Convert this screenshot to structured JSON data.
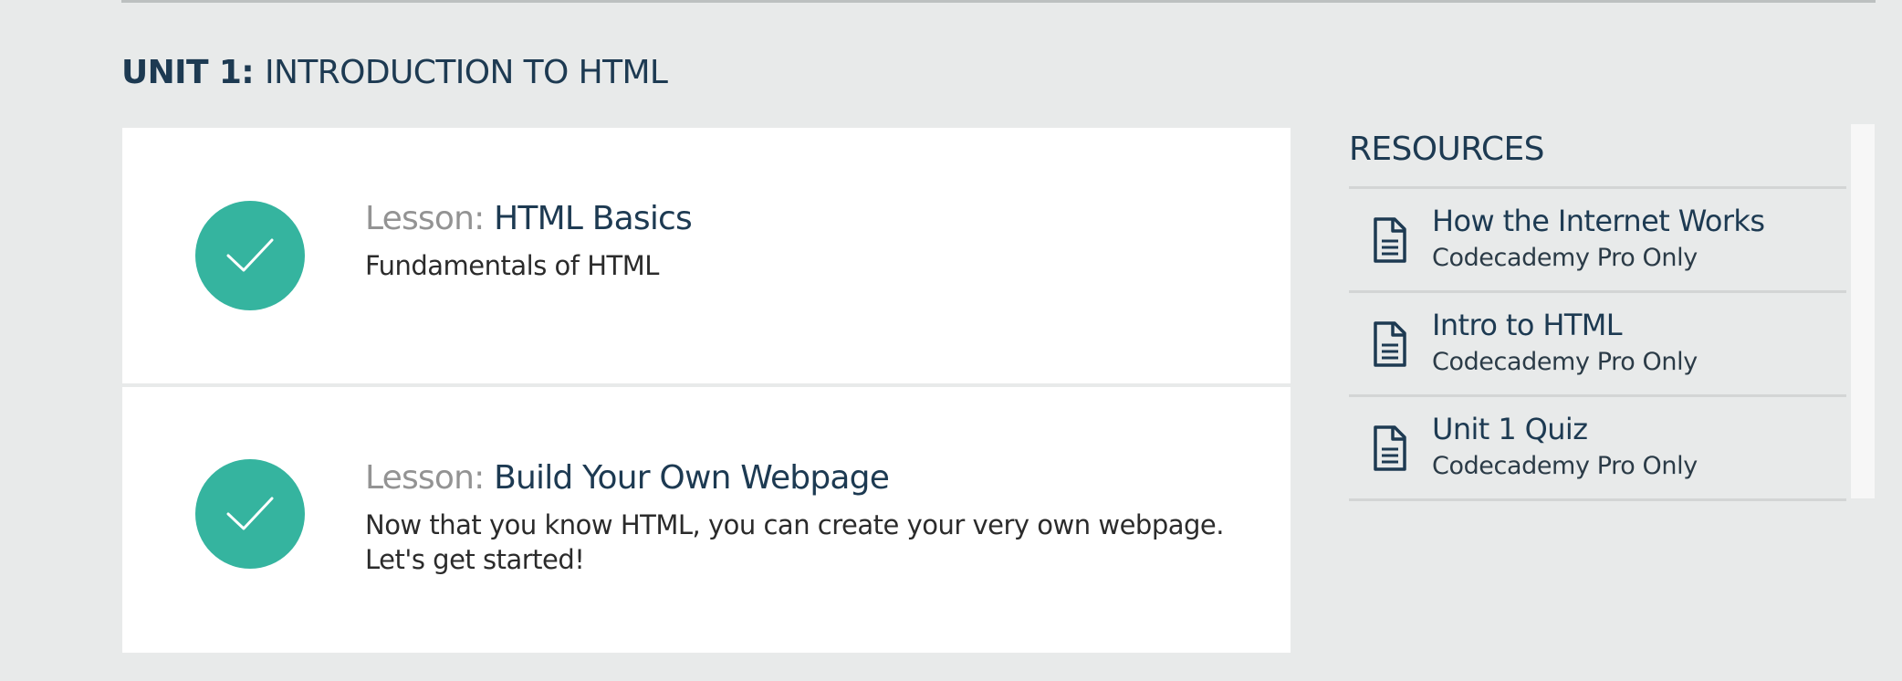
{
  "unit": {
    "number_label": "UNIT 1",
    "separator": ": ",
    "title": "INTRODUCTION TO HTML"
  },
  "lessons": [
    {
      "prefix": "Lesson: ",
      "title": "HTML Basics",
      "description": "Fundamentals of HTML",
      "status_icon": "checkmark-icon",
      "completed": true
    },
    {
      "prefix": "Lesson: ",
      "title": "Build Your Own Webpage",
      "description": "Now that you know HTML, you can create your very own webpage. Let's get started!",
      "status_icon": "checkmark-icon",
      "completed": true
    }
  ],
  "resources": {
    "heading": "RESOURCES",
    "items": [
      {
        "title": "How the Internet Works",
        "subtitle": "Codecademy Pro Only",
        "icon": "document-icon"
      },
      {
        "title": "Intro to HTML",
        "subtitle": "Codecademy Pro Only",
        "icon": "document-icon"
      },
      {
        "title": "Unit 1 Quiz",
        "subtitle": "Codecademy Pro Only",
        "icon": "document-icon"
      }
    ]
  },
  "colors": {
    "background": "#e8eaea",
    "card": "#ffffff",
    "check_green": "#35b49f",
    "heading_navy": "#1d3a52",
    "prefix_gray": "#939393"
  }
}
